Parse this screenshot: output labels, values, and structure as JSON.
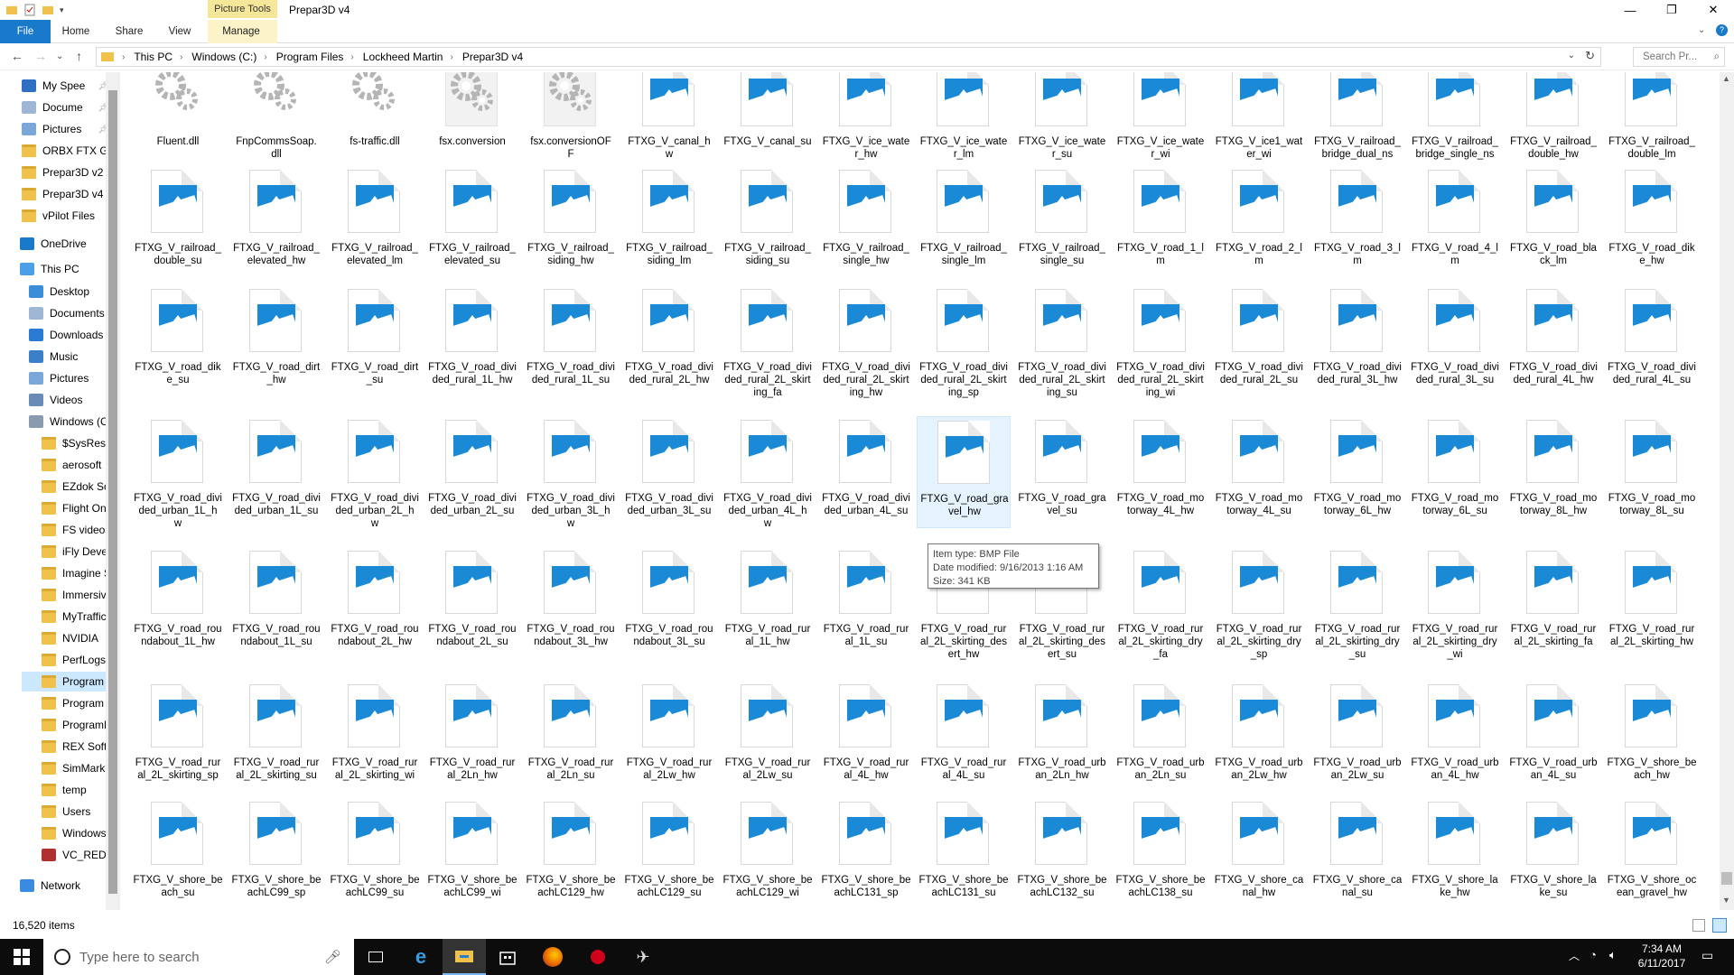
{
  "window": {
    "title": "Prepar3D v4",
    "context_tab": "Picture Tools"
  },
  "ribbon": {
    "tabs": [
      "File",
      "Home",
      "Share",
      "View",
      "Manage"
    ]
  },
  "address": {
    "crumbs": [
      "This PC",
      "Windows (C:)",
      "Program Files",
      "Lockheed Martin",
      "Prepar3D v4"
    ],
    "search_placeholder": "Search Pr..."
  },
  "sidebar": [
    {
      "label": "My Spee",
      "icon": "quick-access-icon"
    },
    {
      "label": "Docume",
      "icon": "documents-icon"
    },
    {
      "label": "Pictures",
      "icon": "pictures-icon"
    },
    {
      "label": "ORBX FTX G",
      "icon": "folder-icon"
    },
    {
      "label": "Prepar3D v2",
      "icon": "folder-icon"
    },
    {
      "label": "Prepar3D v4",
      "icon": "folder-icon"
    },
    {
      "label": "vPilot Files",
      "icon": "folder-icon"
    },
    {
      "label": "OneDrive",
      "icon": "onedrive-icon"
    },
    {
      "label": "This PC",
      "icon": "pc-icon"
    },
    {
      "label": "Desktop",
      "icon": "desktop-icon"
    },
    {
      "label": "Documents",
      "icon": "documents-icon"
    },
    {
      "label": "Downloads",
      "icon": "downloads-icon"
    },
    {
      "label": "Music",
      "icon": "music-icon"
    },
    {
      "label": "Pictures",
      "icon": "pictures-icon"
    },
    {
      "label": "Videos",
      "icon": "videos-icon"
    },
    {
      "label": "Windows (C",
      "icon": "drive-icon"
    },
    {
      "label": "$SysReset",
      "icon": "folder-icon"
    },
    {
      "label": "aerosoft",
      "icon": "folder-icon"
    },
    {
      "label": "EZdok Sof",
      "icon": "folder-icon"
    },
    {
      "label": "Flight One",
      "icon": "folder-icon"
    },
    {
      "label": "FS videos",
      "icon": "folder-icon"
    },
    {
      "label": "iFly Develc",
      "icon": "folder-icon"
    },
    {
      "label": "Imagine Si",
      "icon": "folder-icon"
    },
    {
      "label": "Immersive",
      "icon": "folder-icon"
    },
    {
      "label": "MyTraffic",
      "icon": "folder-icon"
    },
    {
      "label": "NVIDIA",
      "icon": "folder-icon"
    },
    {
      "label": "PerfLogs",
      "icon": "folder-icon"
    },
    {
      "label": "Program F",
      "icon": "folder-icon"
    },
    {
      "label": "Program F",
      "icon": "folder-icon"
    },
    {
      "label": "ProgramD",
      "icon": "folder-icon"
    },
    {
      "label": "REX Soft C",
      "icon": "folder-icon"
    },
    {
      "label": "SimMarke",
      "icon": "folder-icon"
    },
    {
      "label": "temp",
      "icon": "folder-icon"
    },
    {
      "label": "Users",
      "icon": "folder-icon"
    },
    {
      "label": "Windows",
      "icon": "folder-icon"
    },
    {
      "label": "VC_RED",
      "icon": "archive-icon"
    },
    {
      "label": "Network",
      "icon": "network-icon"
    }
  ],
  "files": [
    [
      "Fluent.dll",
      "FnpCommsSoap.\ndll",
      "fs-traffic.dll",
      "fsx.conversion",
      "fsx.conversionOF\nF",
      "FTXG_V_canal_h\nw",
      "FTXG_V_canal_su",
      "FTXG_V_ice_wate\nr_hw",
      "FTXG_V_ice_wate\nr_lm",
      "FTXG_V_ice_wate\nr_su",
      "FTXG_V_ice_wate\nr_wi",
      "FTXG_V_ice1_wat\ner_wi",
      "FTXG_V_railroad_\nbridge_dual_ns",
      "FTXG_V_railroad_\nbridge_single_ns",
      "FTXG_V_railroad_\ndouble_hw",
      "FTXG_V_railroad_\ndouble_lm"
    ],
    [
      "FTXG_V_railroad_\ndouble_su",
      "FTXG_V_railroad_\nelevated_hw",
      "FTXG_V_railroad_\nelevated_lm",
      "FTXG_V_railroad_\nelevated_su",
      "FTXG_V_railroad_\nsiding_hw",
      "FTXG_V_railroad_\nsiding_lm",
      "FTXG_V_railroad_\nsiding_su",
      "FTXG_V_railroad_\nsingle_hw",
      "FTXG_V_railroad_\nsingle_lm",
      "FTXG_V_railroad_\nsingle_su",
      "FTXG_V_road_1_l\nm",
      "FTXG_V_road_2_l\nm",
      "FTXG_V_road_3_l\nm",
      "FTXG_V_road_4_l\nm",
      "FTXG_V_road_bla\nck_lm",
      "FTXG_V_road_dik\ne_hw"
    ],
    [
      "FTXG_V_road_dik\ne_su",
      "FTXG_V_road_dirt\n_hw",
      "FTXG_V_road_dirt\n_su",
      "FTXG_V_road_divi\nded_rural_1L_hw",
      "FTXG_V_road_divi\nded_rural_1L_su",
      "FTXG_V_road_divi\nded_rural_2L_hw",
      "FTXG_V_road_divi\nded_rural_2L_skirt\ning_fa",
      "FTXG_V_road_divi\nded_rural_2L_skirt\ning_hw",
      "FTXG_V_road_divi\nded_rural_2L_skirt\ning_sp",
      "FTXG_V_road_divi\nded_rural_2L_skirt\ning_su",
      "FTXG_V_road_divi\nded_rural_2L_skirt\ning_wi",
      "FTXG_V_road_divi\nded_rural_2L_su",
      "FTXG_V_road_divi\nded_rural_3L_hw",
      "FTXG_V_road_divi\nded_rural_3L_su",
      "FTXG_V_road_divi\nded_rural_4L_hw",
      "FTXG_V_road_divi\nded_rural_4L_su"
    ],
    [
      "FTXG_V_road_divi\nded_urban_1L_h\nw",
      "FTXG_V_road_divi\nded_urban_1L_su",
      "FTXG_V_road_divi\nded_urban_2L_h\nw",
      "FTXG_V_road_divi\nded_urban_2L_su",
      "FTXG_V_road_divi\nded_urban_3L_h\nw",
      "FTXG_V_road_divi\nded_urban_3L_su",
      "FTXG_V_road_divi\nded_urban_4L_h\nw",
      "FTXG_V_road_divi\nded_urban_4L_su",
      "FTXG_V_road_gra\nvel_hw",
      "FTXG_V_road_gra\nvel_su",
      "FTXG_V_road_mo\ntorway_4L_hw",
      "FTXG_V_road_mo\ntorway_4L_su",
      "FTXG_V_road_mo\ntorway_6L_hw",
      "FTXG_V_road_mo\ntorway_6L_su",
      "FTXG_V_road_mo\ntorway_8L_hw",
      "FTXG_V_road_mo\ntorway_8L_su"
    ],
    [
      "FTXG_V_road_rou\nndabout_1L_hw",
      "FTXG_V_road_rou\nndabout_1L_su",
      "FTXG_V_road_rou\nndabout_2L_hw",
      "FTXG_V_road_rou\nndabout_2L_su",
      "FTXG_V_road_rou\nndabout_3L_hw",
      "FTXG_V_road_rou\nndabout_3L_su",
      "FTXG_V_road_rur\nal_1L_hw",
      "FTXG_V_road_rur\nal_1L_su",
      "FTXG_V_road_rur\nal_2L_skirting_des\nert_hw",
      "FTXG_V_road_rur\nal_2L_skirting_des\nert_su",
      "FTXG_V_road_rur\nal_2L_skirting_dry\n_fa",
      "FTXG_V_road_rur\nal_2L_skirting_dry\n_sp",
      "FTXG_V_road_rur\nal_2L_skirting_dry\n_su",
      "FTXG_V_road_rur\nal_2L_skirting_dry\n_wi",
      "FTXG_V_road_rur\nal_2L_skirting_fa",
      "FTXG_V_road_rur\nal_2L_skirting_hw"
    ],
    [
      "FTXG_V_road_rur\nal_2L_skirting_sp",
      "FTXG_V_road_rur\nal_2L_skirting_su",
      "FTXG_V_road_rur\nal_2L_skirting_wi",
      "FTXG_V_road_rur\nal_2Ln_hw",
      "FTXG_V_road_rur\nal_2Ln_su",
      "FTXG_V_road_rur\nal_2Lw_hw",
      "FTXG_V_road_rur\nal_2Lw_su",
      "FTXG_V_road_rur\nal_4L_hw",
      "FTXG_V_road_rur\nal_4L_su",
      "FTXG_V_road_urb\nan_2Ln_hw",
      "FTXG_V_road_urb\nan_2Ln_su",
      "FTXG_V_road_urb\nan_2Lw_hw",
      "FTXG_V_road_urb\nan_2Lw_su",
      "FTXG_V_road_urb\nan_4L_hw",
      "FTXG_V_road_urb\nan_4L_su",
      "FTXG_V_shore_be\nach_hw"
    ],
    [
      "FTXG_V_shore_be\nach_su",
      "FTXG_V_shore_be\nachLC99_sp",
      "FTXG_V_shore_be\nachLC99_su",
      "FTXG_V_shore_be\nachLC99_wi",
      "FTXG_V_shore_be\nachLC129_hw",
      "FTXG_V_shore_be\nachLC129_su",
      "FTXG_V_shore_be\nachLC129_wi",
      "FTXG_V_shore_be\nachLC131_sp",
      "FTXG_V_shore_be\nachLC131_su",
      "FTXG_V_shore_be\nachLC132_su",
      "FTXG_V_shore_be\nachLC138_su",
      "FTXG_V_shore_ca\nnal_hw",
      "FTXG_V_shore_ca\nnal_su",
      "FTXG_V_shore_la\nke_hw",
      "FTXG_V_shore_la\nke_su",
      "FTXG_V_shore_oc\nean_gravel_hw"
    ]
  ],
  "tooltip": {
    "line1": "Item type: BMP File",
    "line2": "Date modified: 9/16/2013 1:16 AM",
    "line3": "Size: 341 KB"
  },
  "status": {
    "count": "16,520 items"
  },
  "taskbar": {
    "search_placeholder": "Type here to search",
    "time": "7:34 AM",
    "date": "6/11/2017"
  },
  "colors": {
    "accent": "#1979ca",
    "image_icon": "#1a8ad6",
    "selection": "#cce8ff"
  }
}
